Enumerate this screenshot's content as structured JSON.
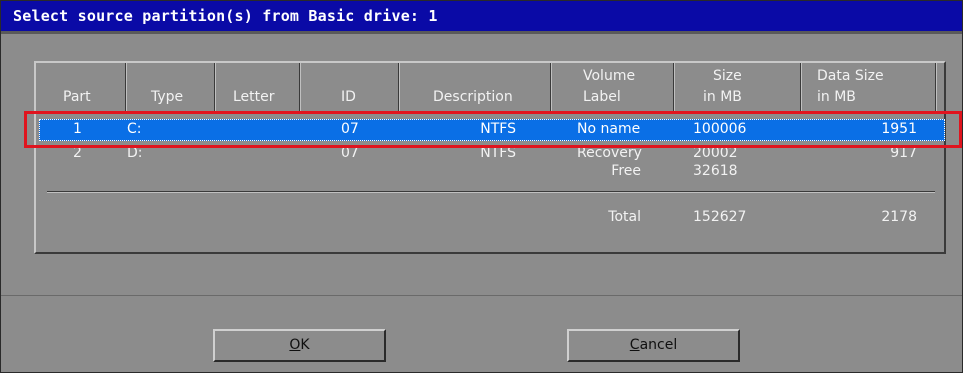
{
  "title": "Select source partition(s) from Basic drive: 1",
  "columns": {
    "part": "Part",
    "type": "Type",
    "letter": "Letter",
    "id": "ID",
    "description": "Description",
    "volume_line1": "Volume",
    "volume_line2": "Label",
    "size_line1": "Size",
    "size_line2": "in MB",
    "datasize_line1": "Data Size",
    "datasize_line2": "in MB"
  },
  "rows": [
    {
      "part": "1",
      "type": "C:",
      "letter": "",
      "id": "07",
      "description": "NTFS",
      "volume_label": "No name",
      "size": "100006",
      "data_size": "1951",
      "selected": true
    },
    {
      "part": "2",
      "type": "D:",
      "letter": "",
      "id": "07",
      "description": "NTFS",
      "volume_label": "Recovery",
      "size": "20002",
      "data_size": "917",
      "selected": false
    }
  ],
  "free": {
    "label": "Free",
    "size": "32618"
  },
  "total": {
    "label": "Total",
    "size": "152627",
    "data_size": "2178"
  },
  "buttons": {
    "ok_hotkey": "O",
    "ok_rest": "K",
    "cancel_hotkey": "C",
    "cancel_rest": "ancel"
  },
  "colors": {
    "title_bar": "#0a0aa6",
    "selection": "#0a6fe6",
    "highlight_box": "#e0141e",
    "panel": "#8c8c8c"
  }
}
